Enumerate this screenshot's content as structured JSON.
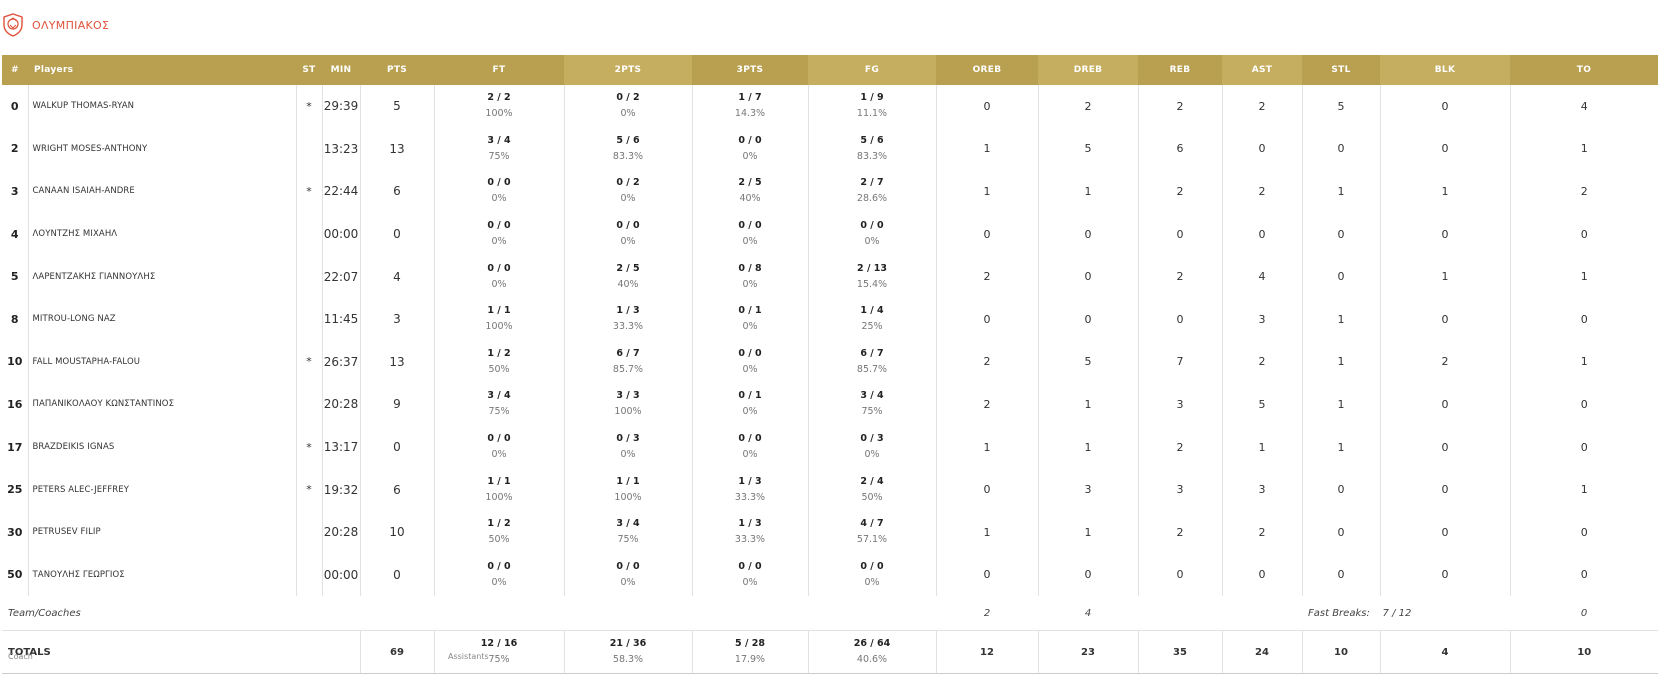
{
  "team": {
    "name": "ΟΛΥΜΠΙΑΚΟΣ",
    "logo_icon": "olympiacos-crest-icon",
    "accent": "#e0513a",
    "header_color": "#b9a050"
  },
  "headers": [
    "#",
    "Players",
    "ST",
    "MIN",
    "PTS",
    "FT",
    "2PTS",
    "3PTS",
    "FG",
    "OREB",
    "DREB",
    "REB",
    "AST",
    "STL",
    "BLK",
    "TO"
  ],
  "players": [
    {
      "num": "0",
      "name": "WALKUP THOMAS-RYAN",
      "st": "*",
      "min": "29:39",
      "pts": "5",
      "ft": "2 / 2",
      "ft_pct": "100%",
      "p2": "0 / 2",
      "p2_pct": "0%",
      "p3": "1 / 7",
      "p3_pct": "14.3%",
      "fg": "1 / 9",
      "fg_pct": "11.1%",
      "oreb": "0",
      "dreb": "2",
      "reb": "2",
      "ast": "2",
      "stl": "5",
      "blk": "0",
      "to": "4"
    },
    {
      "num": "2",
      "name": "WRIGHT MOSES-ANTHONY",
      "st": "",
      "min": "13:23",
      "pts": "13",
      "ft": "3 / 4",
      "ft_pct": "75%",
      "p2": "5 / 6",
      "p2_pct": "83.3%",
      "p3": "0 / 0",
      "p3_pct": "0%",
      "fg": "5 / 6",
      "fg_pct": "83.3%",
      "oreb": "1",
      "dreb": "5",
      "reb": "6",
      "ast": "0",
      "stl": "0",
      "blk": "0",
      "to": "1"
    },
    {
      "num": "3",
      "name": "CANAAN ISAIAH-ANDRE",
      "st": "*",
      "min": "22:44",
      "pts": "6",
      "ft": "0 / 0",
      "ft_pct": "0%",
      "p2": "0 / 2",
      "p2_pct": "0%",
      "p3": "2 / 5",
      "p3_pct": "40%",
      "fg": "2 / 7",
      "fg_pct": "28.6%",
      "oreb": "1",
      "dreb": "1",
      "reb": "2",
      "ast": "2",
      "stl": "1",
      "blk": "1",
      "to": "2"
    },
    {
      "num": "4",
      "name": "ΛΟΥΝΤΖΗΣ ΜΙΧΑΗΛ",
      "st": "",
      "min": "00:00",
      "pts": "0",
      "ft": "0 / 0",
      "ft_pct": "0%",
      "p2": "0 / 0",
      "p2_pct": "0%",
      "p3": "0 / 0",
      "p3_pct": "0%",
      "fg": "0 / 0",
      "fg_pct": "0%",
      "oreb": "0",
      "dreb": "0",
      "reb": "0",
      "ast": "0",
      "stl": "0",
      "blk": "0",
      "to": "0"
    },
    {
      "num": "5",
      "name": "ΛΑΡΕΝΤΖΑΚΗΣ ΓΙΑΝΝΟΥΛΗΣ",
      "st": "",
      "min": "22:07",
      "pts": "4",
      "ft": "0 / 0",
      "ft_pct": "0%",
      "p2": "2 / 5",
      "p2_pct": "40%",
      "p3": "0 / 8",
      "p3_pct": "0%",
      "fg": "2 / 13",
      "fg_pct": "15.4%",
      "oreb": "2",
      "dreb": "0",
      "reb": "2",
      "ast": "4",
      "stl": "0",
      "blk": "1",
      "to": "1"
    },
    {
      "num": "8",
      "name": "MITROU-LONG NAZ",
      "st": "",
      "min": "11:45",
      "pts": "3",
      "ft": "1 / 1",
      "ft_pct": "100%",
      "p2": "1 / 3",
      "p2_pct": "33.3%",
      "p3": "0 / 1",
      "p3_pct": "0%",
      "fg": "1 / 4",
      "fg_pct": "25%",
      "oreb": "0",
      "dreb": "0",
      "reb": "0",
      "ast": "3",
      "stl": "1",
      "blk": "0",
      "to": "0"
    },
    {
      "num": "10",
      "name": "FALL MOUSTAPHA-FALOU",
      "st": "*",
      "min": "26:37",
      "pts": "13",
      "ft": "1 / 2",
      "ft_pct": "50%",
      "p2": "6 / 7",
      "p2_pct": "85.7%",
      "p3": "0 / 0",
      "p3_pct": "0%",
      "fg": "6 / 7",
      "fg_pct": "85.7%",
      "oreb": "2",
      "dreb": "5",
      "reb": "7",
      "ast": "2",
      "stl": "1",
      "blk": "2",
      "to": "1"
    },
    {
      "num": "16",
      "name": "ΠΑΠΑΝΙΚΟΛΑΟΥ ΚΩΝΣΤΑΝΤΙΝΟΣ",
      "st": "",
      "min": "20:28",
      "pts": "9",
      "ft": "3 / 4",
      "ft_pct": "75%",
      "p2": "3 / 3",
      "p2_pct": "100%",
      "p3": "0 / 1",
      "p3_pct": "0%",
      "fg": "3 / 4",
      "fg_pct": "75%",
      "oreb": "2",
      "dreb": "1",
      "reb": "3",
      "ast": "5",
      "stl": "1",
      "blk": "0",
      "to": "0"
    },
    {
      "num": "17",
      "name": "BRAZDEIKIS IGNAS",
      "st": "*",
      "min": "13:17",
      "pts": "0",
      "ft": "0 / 0",
      "ft_pct": "0%",
      "p2": "0 / 3",
      "p2_pct": "0%",
      "p3": "0 / 0",
      "p3_pct": "0%",
      "fg": "0 / 3",
      "fg_pct": "0%",
      "oreb": "1",
      "dreb": "1",
      "reb": "2",
      "ast": "1",
      "stl": "1",
      "blk": "0",
      "to": "0"
    },
    {
      "num": "25",
      "name": "PETERS ALEC-JEFFREY",
      "st": "*",
      "min": "19:32",
      "pts": "6",
      "ft": "1 / 1",
      "ft_pct": "100%",
      "p2": "1 / 1",
      "p2_pct": "100%",
      "p3": "1 / 3",
      "p3_pct": "33.3%",
      "fg": "2 / 4",
      "fg_pct": "50%",
      "oreb": "0",
      "dreb": "3",
      "reb": "3",
      "ast": "3",
      "stl": "0",
      "blk": "0",
      "to": "1"
    },
    {
      "num": "30",
      "name": "PETRUSEV FILIP",
      "st": "",
      "min": "20:28",
      "pts": "10",
      "ft": "1 / 2",
      "ft_pct": "50%",
      "p2": "3 / 4",
      "p2_pct": "75%",
      "p3": "1 / 3",
      "p3_pct": "33.3%",
      "fg": "4 / 7",
      "fg_pct": "57.1%",
      "oreb": "1",
      "dreb": "1",
      "reb": "2",
      "ast": "2",
      "stl": "0",
      "blk": "0",
      "to": "0"
    },
    {
      "num": "50",
      "name": "ΤΑΝΟΥΛΗΣ ΓΕΩΡΓΙΟΣ",
      "st": "",
      "min": "00:00",
      "pts": "0",
      "ft": "0 / 0",
      "ft_pct": "0%",
      "p2": "0 / 0",
      "p2_pct": "0%",
      "p3": "0 / 0",
      "p3_pct": "0%",
      "fg": "0 / 0",
      "fg_pct": "0%",
      "oreb": "0",
      "dreb": "0",
      "reb": "0",
      "ast": "0",
      "stl": "0",
      "blk": "0",
      "to": "0"
    }
  ],
  "team_row": {
    "label": "Team/Coaches",
    "oreb": "2",
    "dreb": "4",
    "fast_breaks_label": "Fast Breaks:",
    "fast_breaks_value": "7 / 12",
    "to": "0"
  },
  "totals": {
    "label": "TOTALS",
    "pts": "69",
    "ft": "12 / 16",
    "ft_pct": "75%",
    "p2": "21 / 36",
    "p2_pct": "58.3%",
    "p3": "5 / 28",
    "p3_pct": "17.9%",
    "fg": "26 / 64",
    "fg_pct": "40.6%",
    "oreb": "12",
    "dreb": "23",
    "reb": "35",
    "ast": "24",
    "stl": "10",
    "blk": "4",
    "to": "10"
  },
  "footer": {
    "coach_label": "Coach",
    "assistants_label": "Assistants"
  }
}
